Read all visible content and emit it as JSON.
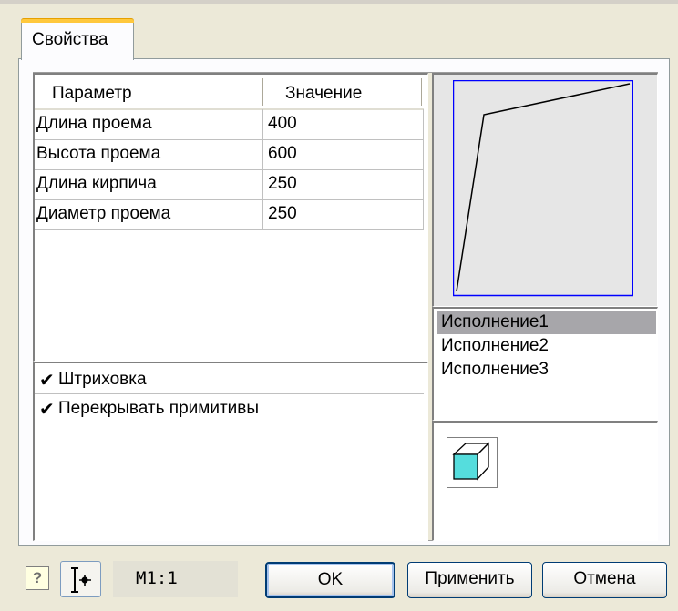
{
  "tab": {
    "label": "Свойства"
  },
  "table": {
    "headers": [
      "Параметр",
      "Значение"
    ],
    "rows": [
      {
        "param": "Длина проема",
        "value": "400"
      },
      {
        "param": "Высота проема",
        "value": "600"
      },
      {
        "param": "Длина кирпича",
        "value": "250"
      },
      {
        "param": "Диаметр проема",
        "value": "250"
      }
    ]
  },
  "options": [
    {
      "label": "Штриховка",
      "checked": true
    },
    {
      "label": "Перекрывать примитивы",
      "checked": true
    }
  ],
  "variants": {
    "items": [
      "Исполнение1",
      "Исполнение2",
      "Исполнение3"
    ],
    "selected": "Исполнение1"
  },
  "footer": {
    "help_icon": "?",
    "scale": "М1:1",
    "ok_label": "OK",
    "apply_label": "Применить",
    "cancel_label": "Отмена"
  },
  "colors": {
    "preview_frame": "#0000FF",
    "cube_fill": "#55DDDD",
    "tab_accent": "#FFC83C"
  }
}
